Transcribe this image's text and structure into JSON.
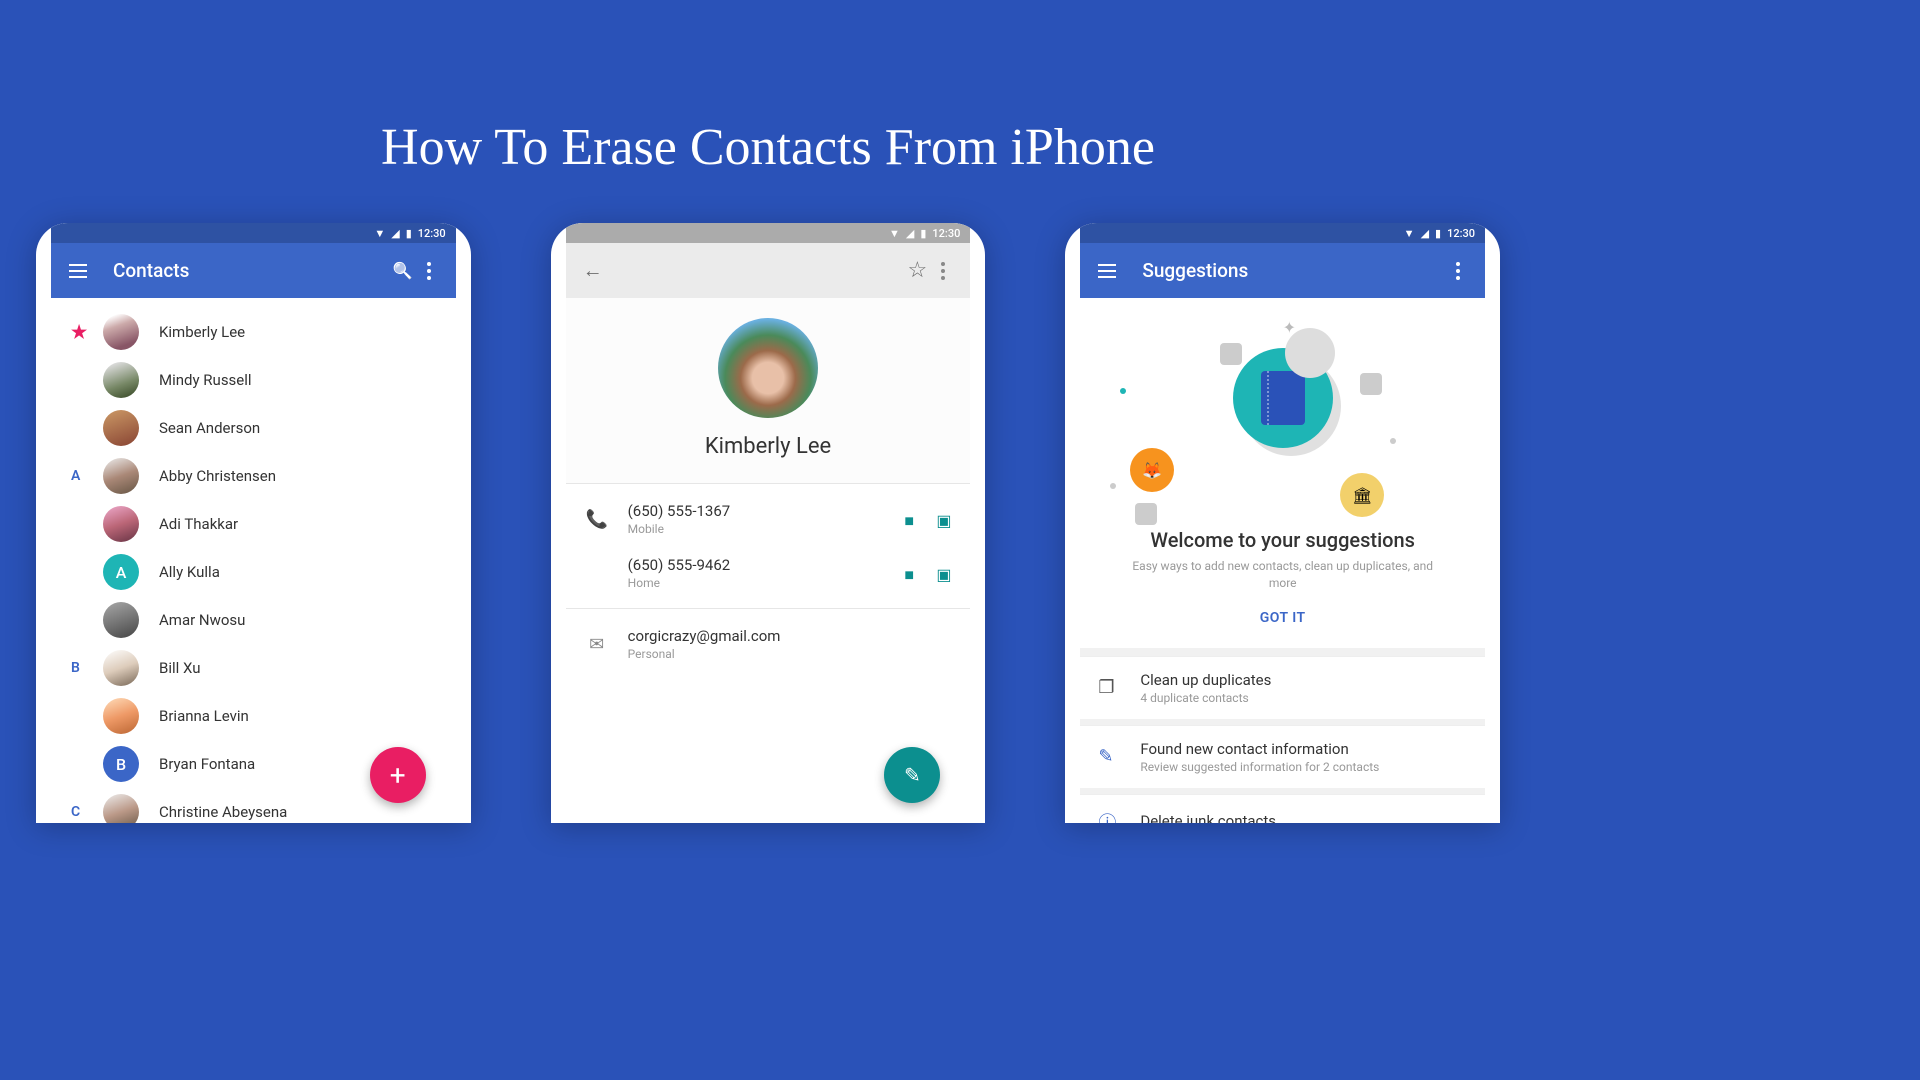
{
  "page": {
    "title": "How To Erase Contacts From iPhone"
  },
  "status": {
    "time": "12:30"
  },
  "screen1": {
    "title": "Contacts",
    "sections": [
      {
        "marker": "★",
        "markerClass": "star",
        "items": [
          {
            "name": "Kimberly Lee",
            "avatarClass": "av1"
          },
          {
            "name": "Mindy Russell",
            "avatarClass": "av2"
          },
          {
            "name": "Sean Anderson",
            "avatarClass": "av3"
          }
        ]
      },
      {
        "marker": "A",
        "markerClass": "",
        "items": [
          {
            "name": "Abby Christensen",
            "avatarClass": "av4"
          },
          {
            "name": "Adi Thakkar",
            "avatarClass": "av5"
          },
          {
            "name": "Ally Kulla",
            "avatarClass": "av6",
            "initial": "A"
          },
          {
            "name": "Amar Nwosu",
            "avatarClass": "av7"
          }
        ]
      },
      {
        "marker": "B",
        "markerClass": "",
        "items": [
          {
            "name": "Bill Xu",
            "avatarClass": "av8"
          },
          {
            "name": "Brianna Levin",
            "avatarClass": "av9"
          },
          {
            "name": "Bryan Fontana",
            "avatarClass": "av10",
            "initial": "B"
          }
        ]
      },
      {
        "marker": "C",
        "markerClass": "",
        "items": [
          {
            "name": "Christine Abeysena",
            "avatarClass": "av11"
          }
        ]
      }
    ]
  },
  "screen2": {
    "name": "Kimberly Lee",
    "phones": [
      {
        "number": "(650) 555-1367",
        "label": "Mobile"
      },
      {
        "number": "(650) 555-9462",
        "label": "Home"
      }
    ],
    "email": {
      "address": "corgicrazy@gmail.com",
      "label": "Personal"
    }
  },
  "screen3": {
    "title": "Suggestions",
    "heroTitle": "Welcome to your suggestions",
    "heroSub": "Easy ways to add new contacts, clean up duplicates, and more",
    "gotIt": "GOT IT",
    "cards": [
      {
        "title": "Clean up duplicates",
        "sub": "4 duplicate contacts"
      },
      {
        "title": "Found new contact information",
        "sub": "Review suggested information for 2 contacts"
      },
      {
        "title": "Delete junk contacts",
        "sub": ""
      }
    ]
  }
}
